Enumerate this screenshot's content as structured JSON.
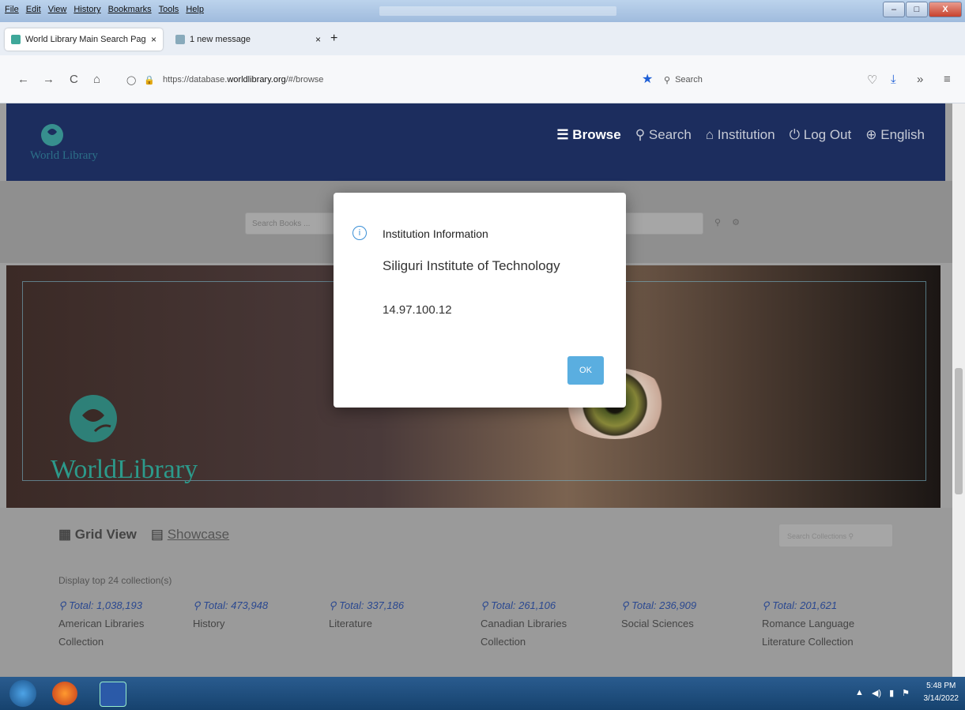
{
  "menubar": {
    "items": [
      "File",
      "Edit",
      "View",
      "History",
      "Bookmarks",
      "Tools",
      "Help"
    ]
  },
  "window_buttons": {
    "minimize": "–",
    "maximize": "□",
    "close": "X"
  },
  "tabs": [
    {
      "title": "World Library Main Search Pag",
      "close": "×"
    },
    {
      "title": "1 new message",
      "close": "×"
    }
  ],
  "newtab": "+",
  "nav": {
    "back": "←",
    "forward": "→",
    "reload": "C",
    "home": "⌂",
    "url_prefix": "https://database.",
    "url_domain": "worldlibrary.org",
    "url_path": "/#/browse",
    "search_placeholder": "Search",
    "overflow": "»",
    "menu": "≡"
  },
  "site": {
    "logo_text": "World Library",
    "nav": [
      {
        "label": "Browse",
        "icon": "☰"
      },
      {
        "label": "Search",
        "icon": "🔍"
      },
      {
        "label": "Institution",
        "icon": "🏛"
      },
      {
        "label": "Log Out",
        "icon": "⏻"
      },
      {
        "label": "English",
        "icon": "🌐"
      }
    ],
    "book_search_placeholder": "Search Books ...",
    "hero_logo_text": "WorldLibrary"
  },
  "content": {
    "grid_view": "Grid View",
    "showcase": "Showcase",
    "collection_search_placeholder": "Search Collections",
    "display_text": "Display top 24 collection(s)",
    "collections": [
      {
        "total": "Total: 1,038,193",
        "name": "American Libraries Collection"
      },
      {
        "total": "Total: 473,948",
        "name": "History"
      },
      {
        "total": "Total: 337,186",
        "name": "Literature"
      },
      {
        "total": "Total: 261,106",
        "name": "Canadian Libraries Collection"
      },
      {
        "total": "Total: 236,909",
        "name": "Social Sciences"
      },
      {
        "total": "Total: 201,621",
        "name": "Romance Language Literature Collection"
      }
    ]
  },
  "modal": {
    "icon": "i",
    "title": "Institution Information",
    "name": "Siliguri Institute of Technology",
    "ip": "14.97.100.12",
    "ok": "OK"
  },
  "taskbar": {
    "time": "5:48 PM",
    "date": "3/14/2022"
  }
}
